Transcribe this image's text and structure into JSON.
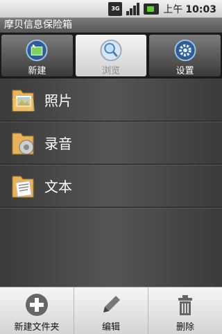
{
  "status_bar": {
    "network": "3G",
    "ampm": "上午",
    "time": "10:03"
  },
  "app": {
    "title": "摩贝信息保险箱"
  },
  "tabs": [
    {
      "label": "新建",
      "icon": "new-icon",
      "active": false
    },
    {
      "label": "浏览",
      "icon": "browse-icon",
      "active": true
    },
    {
      "label": "设置",
      "icon": "settings-icon",
      "active": false
    }
  ],
  "folders": [
    {
      "label": "照片",
      "icon": "photo-folder-icon"
    },
    {
      "label": "录音",
      "icon": "audio-folder-icon"
    },
    {
      "label": "文本",
      "icon": "text-folder-icon"
    }
  ],
  "toolbar": {
    "new_folder_label": "新建文件夹",
    "edit_label": "编辑",
    "delete_label": "删除"
  },
  "colors": {
    "accent_green": "#5dcf2c",
    "tab_active": "#e8e8e8"
  }
}
